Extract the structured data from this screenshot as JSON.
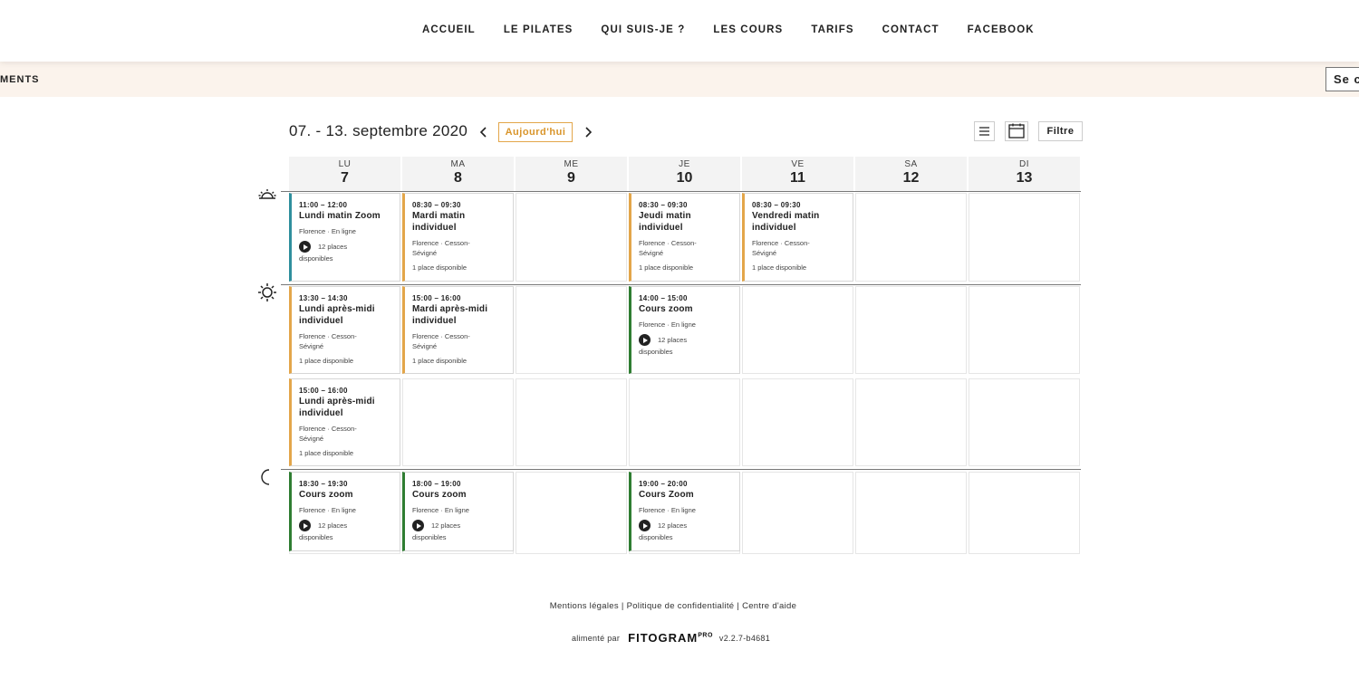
{
  "nav": {
    "items": [
      "ACCUEIL",
      "LE PILATES",
      "QUI SUIS-JE ?",
      "LES COURS",
      "TARIFS",
      "CONTACT",
      "FACEBOOK"
    ]
  },
  "strip": {
    "left_text": "MENTS",
    "login_label": "Se co"
  },
  "calendar": {
    "week_title": "07. - 13. septembre 2020",
    "today_label": "Aujourd'hui",
    "filter_label": "Filtre",
    "days": [
      {
        "name": "LU",
        "date": "7"
      },
      {
        "name": "MA",
        "date": "8"
      },
      {
        "name": "ME",
        "date": "9"
      },
      {
        "name": "JE",
        "date": "10"
      },
      {
        "name": "VE",
        "date": "11"
      },
      {
        "name": "SA",
        "date": "12"
      },
      {
        "name": "DI",
        "date": "13"
      }
    ],
    "periods": [
      "sunrise-icon",
      "sun-icon",
      "moon-icon"
    ],
    "colors": {
      "orange": "#e3a64a",
      "green": "#2f7d32",
      "teal": "#2f8f9d"
    },
    "events": [
      {
        "time": "11:00 – 12:00",
        "title": "Lundi matin Zoom",
        "location": "Florence · En ligne",
        "avail_a": "12 places",
        "avail_b": "disponibles",
        "online": true,
        "color": "teal"
      },
      {
        "time": "08:30 – 09:30",
        "title": "Mardi matin individuel",
        "location": "Florence · Cesson-Sévigné",
        "avail": "1 place disponible",
        "online": false,
        "color": "orange"
      },
      {
        "time": "08:30 – 09:30",
        "title": "Jeudi matin individuel",
        "location": "Florence · Cesson-Sévigné",
        "avail": "1 place disponible",
        "online": false,
        "color": "orange"
      },
      {
        "time": "08:30 – 09:30",
        "title": "Vendredi matin individuel",
        "location": "Florence · Cesson-Sévigné",
        "avail": "1 place disponible",
        "online": false,
        "color": "orange"
      },
      {
        "time": "13:30 – 14:30",
        "title": "Lundi après-midi individuel",
        "location": "Florence · Cesson-Sévigné",
        "avail": "1 place disponible",
        "online": false,
        "color": "orange"
      },
      {
        "time": "15:00 – 16:00",
        "title": "Mardi après-midi individuel",
        "location": "Florence · Cesson-Sévigné",
        "avail": "1 place disponible",
        "online": false,
        "color": "orange"
      },
      {
        "time": "14:00 – 15:00",
        "title": "Cours zoom",
        "location": "Florence · En ligne",
        "avail_a": "12 places",
        "avail_b": "disponibles",
        "online": true,
        "color": "green"
      },
      {
        "time": "15:00 – 16:00",
        "title": "Lundi après-midi individuel",
        "location": "Florence · Cesson-Sévigné",
        "avail": "1 place disponible",
        "online": false,
        "color": "orange"
      },
      {
        "time": "18:30 – 19:30",
        "title": "Cours zoom",
        "location": "Florence · En ligne",
        "avail_a": "12 places",
        "avail_b": "disponibles",
        "online": true,
        "color": "green"
      },
      {
        "time": "18:00 – 19:00",
        "title": "Cours zoom",
        "location": "Florence · En ligne",
        "avail_a": "12 places",
        "avail_b": "disponibles",
        "online": true,
        "color": "green"
      },
      {
        "time": "19:00 – 20:00",
        "title": "Cours Zoom",
        "location": "Florence · En ligne",
        "avail_a": "12 places",
        "avail_b": "disponibles",
        "online": true,
        "color": "green"
      }
    ]
  },
  "footer": {
    "mentions": "Mentions légales",
    "separator": "|",
    "privacy": "Politique de confidentialité",
    "help": "Centre d'aide",
    "powered_by": "alimenté par",
    "brand": "FITOGRAM",
    "brand_sup": "PRO",
    "version": "v2.2.7-b4681"
  }
}
